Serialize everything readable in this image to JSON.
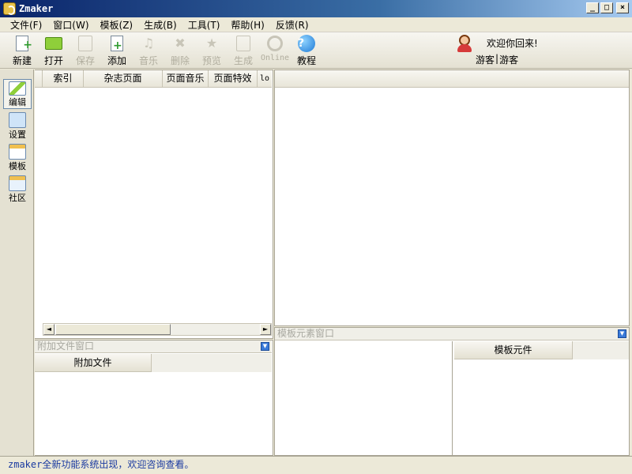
{
  "window": {
    "title": "Zmaker",
    "minimize": "_",
    "maximize": "□",
    "close": "×"
  },
  "menu": [
    {
      "label": "文件(F)"
    },
    {
      "label": "窗口(W)"
    },
    {
      "label": "模板(Z)"
    },
    {
      "label": "生成(B)"
    },
    {
      "label": "工具(T)"
    },
    {
      "label": "帮助(H)"
    },
    {
      "label": "反馈(R)"
    }
  ],
  "toolbar": {
    "new": "新建",
    "open": "打开",
    "save": "保存",
    "add": "添加",
    "music": "音乐",
    "delete": "删除",
    "preview": "预览",
    "generate": "生成",
    "online": "Online",
    "tutorial": "教程",
    "help_glyph": "?",
    "welcome": "欢迎你回来!",
    "user_link_1": "游客",
    "user_sep": "|",
    "user_link_2": "游客"
  },
  "leftnav": {
    "items": [
      {
        "label": "编辑",
        "icon": "edit-icon"
      },
      {
        "label": "设置",
        "icon": "settings-icon"
      },
      {
        "label": "模板",
        "icon": "template-icon"
      },
      {
        "label": "社区",
        "icon": "community-icon"
      }
    ]
  },
  "pages_grid": {
    "columns": [
      "索引",
      "杂志页面",
      "页面音乐",
      "页面特效",
      "lo"
    ]
  },
  "scroll": {
    "left": "◄",
    "right": "►"
  },
  "attach_window": {
    "caption": "附加文件窗口",
    "header": "附加文件",
    "drop": "▼"
  },
  "template_window": {
    "caption": "模板元素窗口",
    "header": "模板元件",
    "drop": "▼"
  },
  "status": {
    "text": "zmaker全新功能系统出现，欢迎咨询查看。"
  },
  "colors": {
    "titlebar": "#0a246a",
    "status_text": "#1a3aa0",
    "panel_border": "#a8a494"
  }
}
